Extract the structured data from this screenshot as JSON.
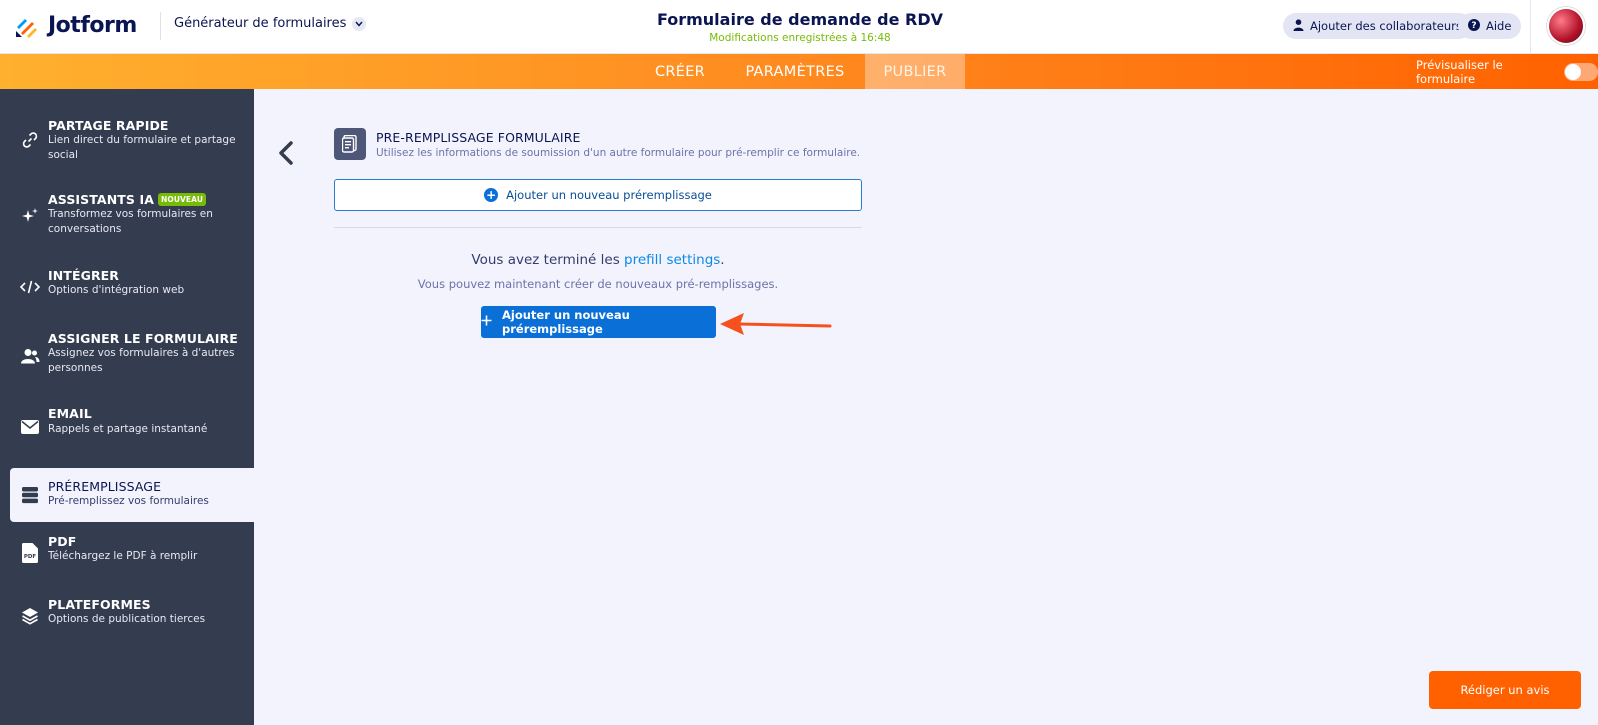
{
  "header": {
    "logo_text": "Jotform",
    "builder_menu_label": "Générateur de formulaires",
    "form_title": "Formulaire de demande de RDV",
    "saved_status": "Modifications enregistrées à 16:48",
    "collaborators_label": "Ajouter des collaborateurs",
    "help_label": "Aide"
  },
  "nav": {
    "tabs": [
      {
        "label": "CRÉER",
        "active": false
      },
      {
        "label": "PARAMÈTRES",
        "active": false
      },
      {
        "label": "PUBLIER",
        "active": true
      }
    ],
    "preview_label": "Prévisualiser le formulaire",
    "preview_on": false
  },
  "sidebar": {
    "items": [
      {
        "title": "PARTAGE RAPIDE",
        "desc": "Lien direct du formulaire et partage social",
        "icon": "link-icon"
      },
      {
        "title": "ASSISTANTS IA",
        "badge": "NOUVEAU",
        "desc": "Transformez vos formulaires en conversations",
        "icon": "sparkle-icon"
      },
      {
        "title": "INTÉGRER",
        "desc": "Options d'intégration web",
        "icon": "code-icon"
      },
      {
        "title": "ASSIGNER LE FORMULAIRE",
        "desc": "Assignez vos formulaires à d'autres personnes",
        "icon": "users-icon"
      },
      {
        "title": "EMAIL",
        "desc": "Rappels et partage instantané",
        "icon": "mail-icon"
      },
      {
        "title": "PRÉREMPLISSAGE",
        "desc": "Pré-remplissez vos formulaires",
        "icon": "prefill-icon",
        "active": true
      },
      {
        "title": "PDF",
        "desc": "Téléchargez le PDF à remplir",
        "icon": "pdf-icon"
      },
      {
        "title": "PLATEFORMES",
        "desc": "Options de publication tierces",
        "icon": "layers-icon"
      }
    ]
  },
  "main": {
    "section_title": "PRE-REMPLISSAGE FORMULAIRE",
    "section_subtitle": "Utilisez les informations de soumission d'un autre formulaire pour pré-remplir ce formulaire.",
    "add_outline_label": "Ajouter un nouveau préremplissage",
    "done_prefix": "Vous avez terminé les ",
    "done_link": "prefill settings",
    "done_suffix": ".",
    "info_text": "Vous pouvez maintenant créer de nouveaux pré-remplissages.",
    "add_primary_label": "Ajouter un nouveau préremplissage"
  },
  "review_button_label": "Rédiger un avis",
  "colors": {
    "accent_orange": "#ff6100",
    "primary_blue": "#0a70d8",
    "sidebar_bg": "#343c4f",
    "saved_green": "#78bb07"
  }
}
